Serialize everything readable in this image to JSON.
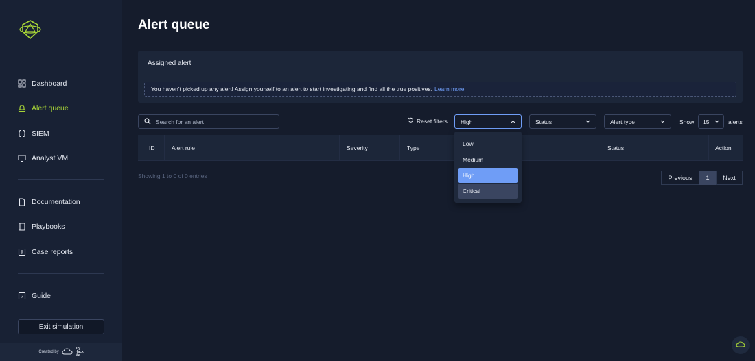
{
  "app": {
    "page_title": "Alert queue",
    "accent_color": "#a7d437",
    "link_color": "#6f9df6"
  },
  "sidebar": {
    "items": [
      {
        "label": "Dashboard",
        "icon": "dashboard-icon"
      },
      {
        "label": "Alert queue",
        "icon": "alert-queue-icon",
        "active": true
      },
      {
        "label": "SIEM",
        "icon": "code-braces-icon"
      },
      {
        "label": "Analyst VM",
        "icon": "monitor-icon"
      },
      {
        "label": "Documentation",
        "icon": "document-icon"
      },
      {
        "label": "Playbooks",
        "icon": "book-icon"
      },
      {
        "label": "Case reports",
        "icon": "report-icon"
      },
      {
        "label": "Guide",
        "icon": "question-icon"
      }
    ],
    "exit_label": "Exit simulation",
    "created_by": "Created by",
    "brand_lines": [
      "Try",
      "Hack",
      "Me"
    ]
  },
  "assigned": {
    "title": "Assigned alert",
    "message": "You haven't picked up any alert! Assign yourself to an alert to start investigating and find all the true positives.",
    "link": "Learn more"
  },
  "filters": {
    "search_placeholder": "Search for an alert",
    "reset_label": "Reset filters",
    "severity_value": "High",
    "status_value": "Status",
    "type_value": "Alert type",
    "show_label": "Show",
    "page_size": "15",
    "alerts_label": "alerts"
  },
  "table": {
    "columns": [
      "ID",
      "Alert rule",
      "Severity",
      "Type",
      "",
      "Status",
      "Action"
    ],
    "showing": "Showing 1 to 0 of 0 entries"
  },
  "pagination": {
    "previous": "Previous",
    "current": "1",
    "next": "Next"
  },
  "severity_dropdown": {
    "options": [
      "Low",
      "Medium",
      "High",
      "Critical"
    ],
    "selected": "High",
    "hovered": "Critical"
  }
}
